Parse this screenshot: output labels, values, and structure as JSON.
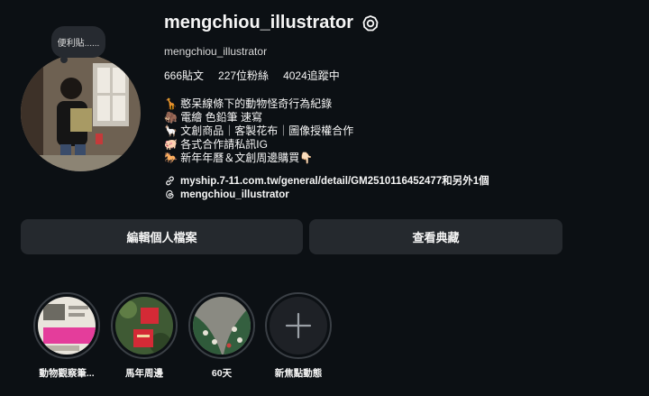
{
  "profile": {
    "username": "mengchiou_illustrator",
    "full_name": "mengchiou_illustrator",
    "note": "便利貼......",
    "stats": {
      "posts": "666貼文",
      "followers": "227位粉絲",
      "following": "4024追蹤中"
    },
    "bio": [
      "🦒 憨呆線條下的動物怪奇行為紀錄",
      "🦣 電繪 色鉛筆 速寫",
      "🦙 文創商品｜客製花布｜圖像授權合作",
      "🐖 各式合作請私訊IG",
      "🐎 新年年曆＆文創周邊購買👇🏻"
    ],
    "link_text": "myship.7-11.com.tw/general/detail/GM2510116452477和另外1個",
    "threads_handle": "mengchiou_illustrator"
  },
  "buttons": {
    "edit_profile": "編輯個人檔案",
    "view_archive": "查看典藏"
  },
  "highlights": [
    {
      "label": "動物觀察筆...",
      "icon": "animal-notes-thumb"
    },
    {
      "label": "馬年周邊",
      "icon": "red-packet-thumb"
    },
    {
      "label": "60天",
      "icon": "tree-thumb"
    },
    {
      "label": "新焦點動態",
      "icon": "plus-icon"
    }
  ],
  "colors": {
    "background": "#0c1014",
    "button": "#25292e",
    "text": "#f5f5f5"
  }
}
